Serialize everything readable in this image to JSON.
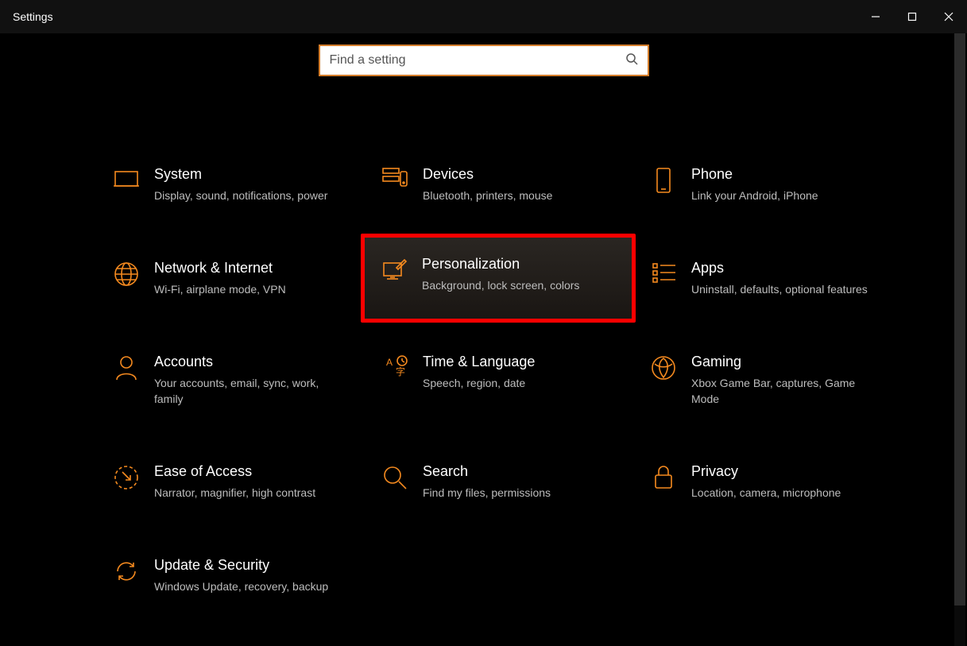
{
  "window": {
    "title": "Settings"
  },
  "search": {
    "placeholder": "Find a setting"
  },
  "tiles": {
    "system": {
      "title": "System",
      "desc": "Display, sound, notifications, power"
    },
    "devices": {
      "title": "Devices",
      "desc": "Bluetooth, printers, mouse"
    },
    "phone": {
      "title": "Phone",
      "desc": "Link your Android, iPhone"
    },
    "network": {
      "title": "Network & Internet",
      "desc": "Wi-Fi, airplane mode, VPN"
    },
    "personalization": {
      "title": "Personalization",
      "desc": "Background, lock screen, colors"
    },
    "apps": {
      "title": "Apps",
      "desc": "Uninstall, defaults, optional features"
    },
    "accounts": {
      "title": "Accounts",
      "desc": "Your accounts, email, sync, work, family"
    },
    "time": {
      "title": "Time & Language",
      "desc": "Speech, region, date"
    },
    "gaming": {
      "title": "Gaming",
      "desc": "Xbox Game Bar, captures, Game Mode"
    },
    "ease": {
      "title": "Ease of Access",
      "desc": "Narrator, magnifier, high contrast"
    },
    "searchcat": {
      "title": "Search",
      "desc": "Find my files, permissions"
    },
    "privacy": {
      "title": "Privacy",
      "desc": "Location, camera, microphone"
    },
    "update": {
      "title": "Update & Security",
      "desc": "Windows Update, recovery, backup"
    }
  },
  "highlighted": "personalization",
  "colors": {
    "accent": "#f58a1f",
    "highlight_border": "#ff0000"
  }
}
